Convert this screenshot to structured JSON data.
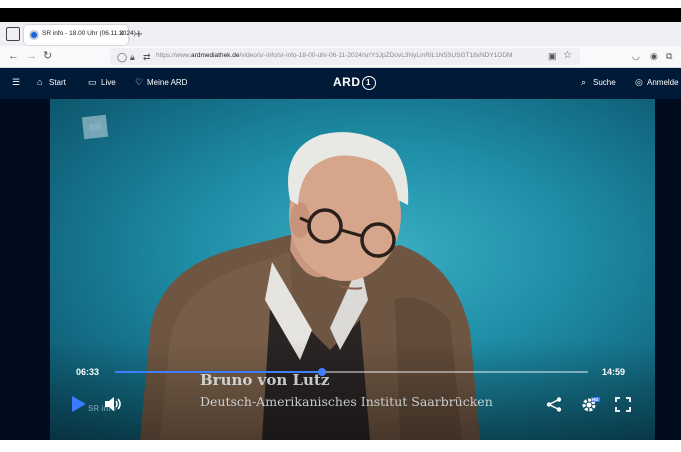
{
  "browser": {
    "tab_title": "SR info - 18.00 Uhr (06.11.2024)",
    "tab_close": "×",
    "new_tab": "+",
    "url_prefix": "https://www.",
    "url_domain": "ardmediathek.de",
    "url_path": "/video/sr-info/sr-info-18-00-uhr-06-11-2024/sr/Y3JpZDovL3NyLmRlL1N5SUSGT18xNDY1ODM"
  },
  "site_header": {
    "menu_icon": "menu-icon",
    "start_label": "Start",
    "live_label": "Live",
    "meine_ard_label": "Meine ARD",
    "logo_text": "ARD",
    "logo_number": "1",
    "search_label": "Suche",
    "login_label": "Anmelde"
  },
  "video": {
    "channel_logo": "SR",
    "watermark": "SR info",
    "lower_third_name": "Bruno von Lutz",
    "lower_third_institution": "Deutsch-Amerikanisches Institut Saarbrücken"
  },
  "player": {
    "current_time": "06:33",
    "duration": "14:59",
    "progress_fraction": 0.437,
    "hd_badge": "HD",
    "accent_color": "#3a7bff"
  }
}
